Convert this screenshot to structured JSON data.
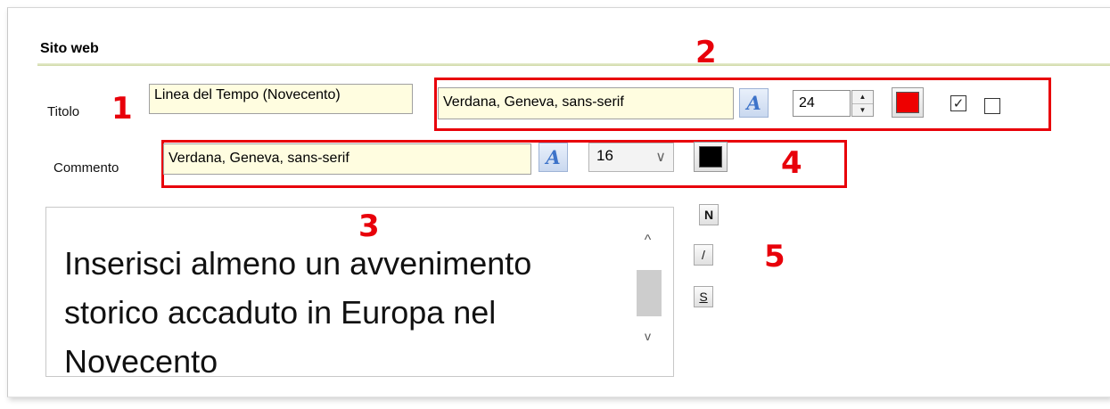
{
  "section": {
    "title": "Sito web"
  },
  "titolo": {
    "label": "Titolo",
    "value": "Linea del Tempo (Novecento)",
    "font": "Verdana, Geneva, sans-serif",
    "font_icon": "A",
    "size": "24",
    "color": "#ee0000",
    "checkbox_checked_symbol": "✓"
  },
  "commento": {
    "label": "Commento",
    "font": "Verdana, Geneva, sans-serif",
    "font_icon": "A",
    "size": "16",
    "color": "#000000"
  },
  "textarea": {
    "text": "Inserisci almeno un avvenimento storico accaduto in Europa nel Novecento"
  },
  "format_buttons": {
    "bold": "N",
    "italic": "/",
    "underline": "S"
  },
  "annotations": {
    "n1": "1",
    "n2": "2",
    "n3": "3",
    "n4": "4",
    "n5": "5"
  },
  "icons": {
    "spin": [
      "arrow-up-icon",
      "arrow-down-icon"
    ],
    "scroll_up": "^",
    "scroll_down": "v",
    "chevron": "∨"
  },
  "accent_color": "#e8000a"
}
